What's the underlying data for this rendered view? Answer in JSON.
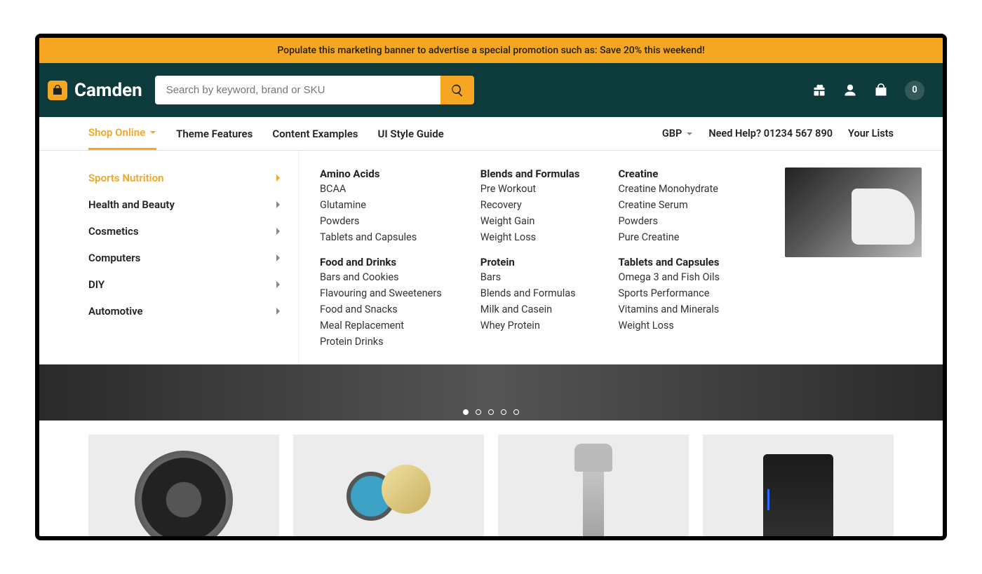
{
  "promo": {
    "text": "Populate this marketing banner to advertise a special promotion such as: Save 20% this weekend!"
  },
  "brand": {
    "name": "Camden"
  },
  "search": {
    "placeholder": "Search by keyword, brand or SKU"
  },
  "cart": {
    "count": "0"
  },
  "nav": {
    "items": [
      {
        "label": "Shop Online",
        "active": true,
        "has_chevron": true
      },
      {
        "label": "Theme Features"
      },
      {
        "label": "Content Examples"
      },
      {
        "label": "UI Style Guide"
      }
    ],
    "currency": "GBP",
    "help": "Need Help? 01234 567 890",
    "lists": "Your Lists"
  },
  "mega": {
    "categories": [
      {
        "label": "Sports Nutrition",
        "active": true
      },
      {
        "label": "Health and Beauty"
      },
      {
        "label": "Cosmetics"
      },
      {
        "label": "Computers"
      },
      {
        "label": "DIY"
      },
      {
        "label": "Automotive"
      }
    ],
    "columns": [
      [
        {
          "title": "Amino Acids",
          "links": [
            "BCAA",
            "Glutamine",
            "Powders",
            "Tablets and Capsules"
          ]
        },
        {
          "title": "Food and Drinks",
          "links": [
            "Bars and Cookies",
            "Flavouring and Sweeteners",
            "Food and Snacks",
            "Meal Replacement",
            "Protein Drinks"
          ]
        }
      ],
      [
        {
          "title": "Blends and Formulas",
          "links": [
            "Pre Workout",
            "Recovery",
            "Weight Gain",
            "Weight Loss"
          ]
        },
        {
          "title": "Protein",
          "links": [
            "Bars",
            "Blends and Formulas",
            "Milk and Casein",
            "Whey Protein"
          ]
        }
      ],
      [
        {
          "title": "Creatine",
          "links": [
            "Creatine Monohydrate",
            "Creatine Serum",
            "Powders",
            "Pure Creatine"
          ]
        },
        {
          "title": "Tablets and Capsules",
          "links": [
            "Omega 3 and Fish Oils",
            "Sports Performance",
            "Vitamins and Minerals",
            "Weight Loss"
          ]
        }
      ]
    ]
  },
  "carousel": {
    "total": 5,
    "active": 0
  }
}
